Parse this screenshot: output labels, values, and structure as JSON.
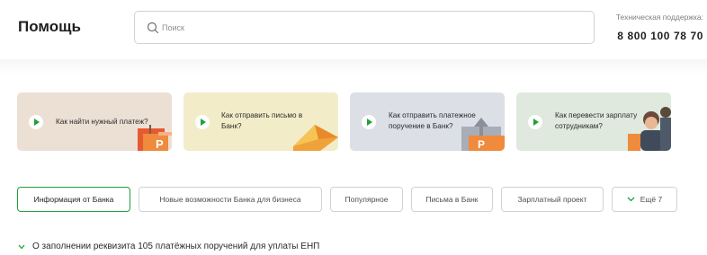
{
  "header": {
    "title": "Помощь",
    "search": {
      "placeholder": "Поиск",
      "value": ""
    },
    "support_label": "Техническая поддержка:",
    "support_phone": "8 800 100 78 70"
  },
  "video_cards": [
    {
      "label": "Как найти нужный платеж?",
      "bg": "#ece0d4",
      "icon": "document-p-icon"
    },
    {
      "label": "Как отправить письмо в Банк?",
      "bg": "#f3ecc9",
      "icon": "envelope-icon"
    },
    {
      "label": "Как отправить платежное поручение в Банк?",
      "bg": "#dcdfe6",
      "icon": "upload-document-icon"
    },
    {
      "label": "Как перевести зарплату сотрудникам?",
      "bg": "#dfe9dd",
      "icon": "employees-icon"
    }
  ],
  "filters": [
    {
      "label": "Информация от Банка",
      "active": true
    },
    {
      "label": "Новые возможности Банка для бизнеса",
      "active": false
    },
    {
      "label": "Популярное",
      "active": false
    },
    {
      "label": "Письма в Банк",
      "active": false
    },
    {
      "label": "Зарплатный проект",
      "active": false
    },
    {
      "label": "Ещё 7",
      "active": false
    }
  ],
  "accordion": {
    "title": "О заполнении реквизита 105 платёжных поручений для уплаты ЕНП"
  },
  "colors": {
    "accent": "#21a038",
    "border": "#cfd3d6",
    "play_arrow": "#21a038",
    "orange": "#f08a3c"
  }
}
